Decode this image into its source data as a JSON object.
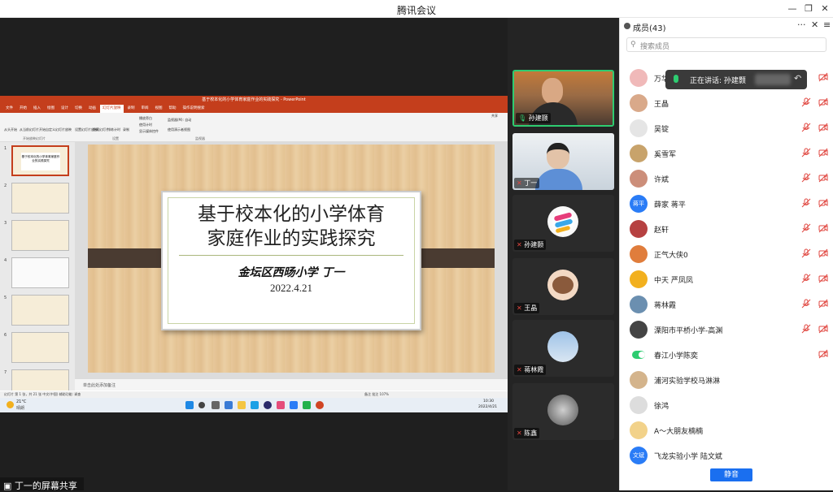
{
  "window": {
    "title": "腾讯会议",
    "min_label": "—",
    "restore_label": "❐",
    "close_label": "✕"
  },
  "ppt": {
    "window_title": "基于校本化的小学体育家庭作业的实践探究 - PowerPoint",
    "tabs": [
      "文件",
      "开始",
      "插入",
      "绘图",
      "设计",
      "切换",
      "动画",
      "幻灯片放映",
      "录制",
      "审阅",
      "视图",
      "帮助",
      "操作说明搜索"
    ],
    "active_tab": "幻灯片放映",
    "ribbon_groups": [
      "开始放映幻灯片",
      "设置",
      "监视器"
    ],
    "ribbon": {
      "from_start": "从头开始",
      "from_current": "从当前幻灯片开始",
      "custom": "自定义幻灯片放映",
      "setup": "设置幻灯片放映",
      "hide": "隐藏幻灯片",
      "rehearse": "排练计时",
      "record": "录制",
      "cb1": "播放旁白",
      "cb2": "使用计时",
      "cb3": "显示媒体控件",
      "monitor": "监视器(M): 自动",
      "presenter": "使用演示者视图",
      "share": "共享"
    },
    "slide": {
      "title_line1": "基于校本化的小学体育",
      "title_line2": "家庭作业的实践探究",
      "school": "金坛区西旸小学  丁一",
      "date": "2022.4.21"
    },
    "thumb_numbers": [
      "1",
      "2",
      "3",
      "4",
      "5",
      "6",
      "7"
    ],
    "thumb1_text": "基于校本化的小学体育家庭作业的实践探究",
    "notes": "单击此处添加备注",
    "status": "幻灯片 第 1 张，共 21 张    中文(中国)    辅助功能: 调查",
    "status_right": "备注    批注    107%",
    "weather_temp": "21°C",
    "weather_desc": "晴朗",
    "clock_time": "10:30",
    "clock_date": "2022/4/21"
  },
  "gallery": [
    {
      "name": "孙建颢",
      "speaking": true
    },
    {
      "name": "丁一",
      "speaking": false
    },
    {
      "name": "孙建颢",
      "speaking": false
    },
    {
      "name": "王晶",
      "speaking": false
    },
    {
      "name": "蒋林霞",
      "speaking": false
    },
    {
      "name": "陈鑫",
      "speaking": false
    }
  ],
  "panel": {
    "title": "成员(43)",
    "search_placeholder": "搜索成员",
    "speaking_label": "正在讲话: 孙建颢",
    "members": [
      {
        "name": "万华"
      },
      {
        "name": "王晶"
      },
      {
        "name": "吴锭"
      },
      {
        "name": "奚雪军"
      },
      {
        "name": "许斌"
      },
      {
        "name": "薛家 蒋平",
        "avatar_text": "蒋平"
      },
      {
        "name": "赵轩"
      },
      {
        "name": "正气大侠0"
      },
      {
        "name": "中天 严凤凤"
      },
      {
        "name": "蒋林霞"
      },
      {
        "name": "溧阳市平桥小学-高渊"
      },
      {
        "name": "春江小学陈奕"
      },
      {
        "name": "浦河实验学校马淋淋"
      },
      {
        "name": "徐鸿"
      },
      {
        "name": "A～大朋友楠楠"
      },
      {
        "name": "飞龙实验小学 陆文斌",
        "avatar_text": "文斌"
      }
    ],
    "mute_all": "静音"
  },
  "share_label": "丁一的屏幕共享",
  "colors": {
    "accent": "#1a6ff0",
    "ppt": "#c43e1c",
    "muted": "#e0463f",
    "speaking": "#2ecc71"
  }
}
